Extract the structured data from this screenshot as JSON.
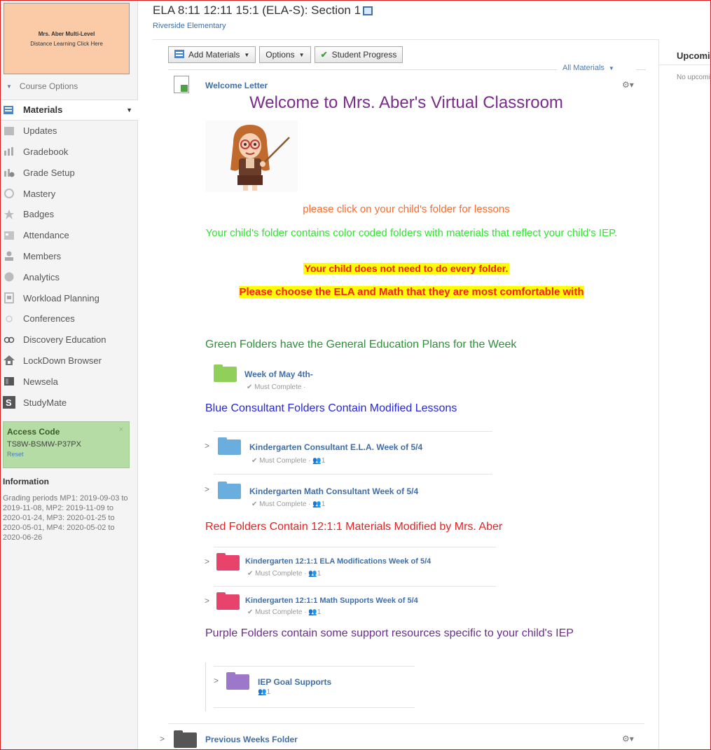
{
  "sidebar": {
    "course_pic_line1": "Mrs. Aber Multi-Level",
    "course_pic_line2": "Distance Learning Click Here",
    "course_options": "Course Options",
    "nav": {
      "materials": "Materials",
      "updates": "Updates",
      "gradebook": "Gradebook",
      "grade_setup": "Grade Setup",
      "mastery": "Mastery",
      "badges": "Badges",
      "attendance": "Attendance",
      "members": "Members",
      "analytics": "Analytics",
      "workload": "Workload Planning",
      "conferences": "Conferences",
      "discovery": "Discovery Education",
      "lockdown": "LockDown Browser",
      "newsela": "Newsela",
      "studymate": "StudyMate"
    },
    "access": {
      "heading": "Access Code",
      "code": "TS8W-BSMW-P37PX",
      "reset": "Reset",
      "close": "×"
    },
    "information": {
      "heading": "Information",
      "text": "Grading periods MP1: 2019-09-03 to 2019-11-08, MP2: 2019-11-09 to 2020-01-24, MP3: 2020-01-25 to 2020-05-01, MP4: 2020-05-02 to 2020-06-26"
    }
  },
  "header": {
    "course_title": "ELA 8:11 12:11 15:1 (ELA-S): Section 1",
    "school": "Riverside Elementary"
  },
  "toolbar": {
    "add_materials": "Add Materials",
    "options": "Options",
    "student_progress": "Student Progress",
    "all_materials": "All Materials"
  },
  "right": {
    "heading": "Upcoming",
    "empty": "No upcoming"
  },
  "content": {
    "welcome_link": "Welcome Letter",
    "welcome_heading": "Welcome to Mrs. Aber's Virtual Classroom",
    "line_orange": "please click on your child's folder for lessons",
    "line_green": "Your child's folder contains color coded folders with materials that reflect your child's IEP.",
    "line_hl1": "Your child does not need to do every folder.",
    "line_hl2": "Please choose the ELA and Math that they are most comfortable with",
    "sec_green": "Green Folders have the General Education Plans for the Week",
    "sec_blue": "Blue Consultant Folders Contain Modified Lessons",
    "sec_red": "Red Folders Contain 12:1:1 Materials Modified by Mrs. Aber",
    "sec_purple": "Purple Folders contain some support resources specific to your child's IEP"
  },
  "folders": {
    "week": {
      "title": "Week of May 4th-",
      "meta": "✔ Must Complete ·",
      "color": "#8fcf5a"
    },
    "kc_ela": {
      "title": "Kindergarten Consultant E.L.A. Week of 5/4",
      "meta": "✔ Must Complete · 👥1",
      "color": "#6aaee0"
    },
    "kc_math": {
      "title": "Kindergarten Math Consultant Week of 5/4",
      "meta": "✔ Must Complete · 👥1",
      "color": "#6aaee0"
    },
    "k121_ela": {
      "title": "Kindergarten 12:1:1 ELA Modifications Week of 5/4",
      "meta": "✔ Must Complete · 👥1",
      "color": "#e8436b"
    },
    "k121_math": {
      "title": "Kindergarten 12:1:1 Math Supports Week of 5/4",
      "meta": "✔ Must Complete · 👥1",
      "color": "#e8436b"
    },
    "iep": {
      "title": "IEP Goal Supports",
      "meta": "👥1",
      "color": "#9d77c9"
    },
    "prev": {
      "title": "Previous Weeks Folder",
      "color": "#555555"
    }
  }
}
